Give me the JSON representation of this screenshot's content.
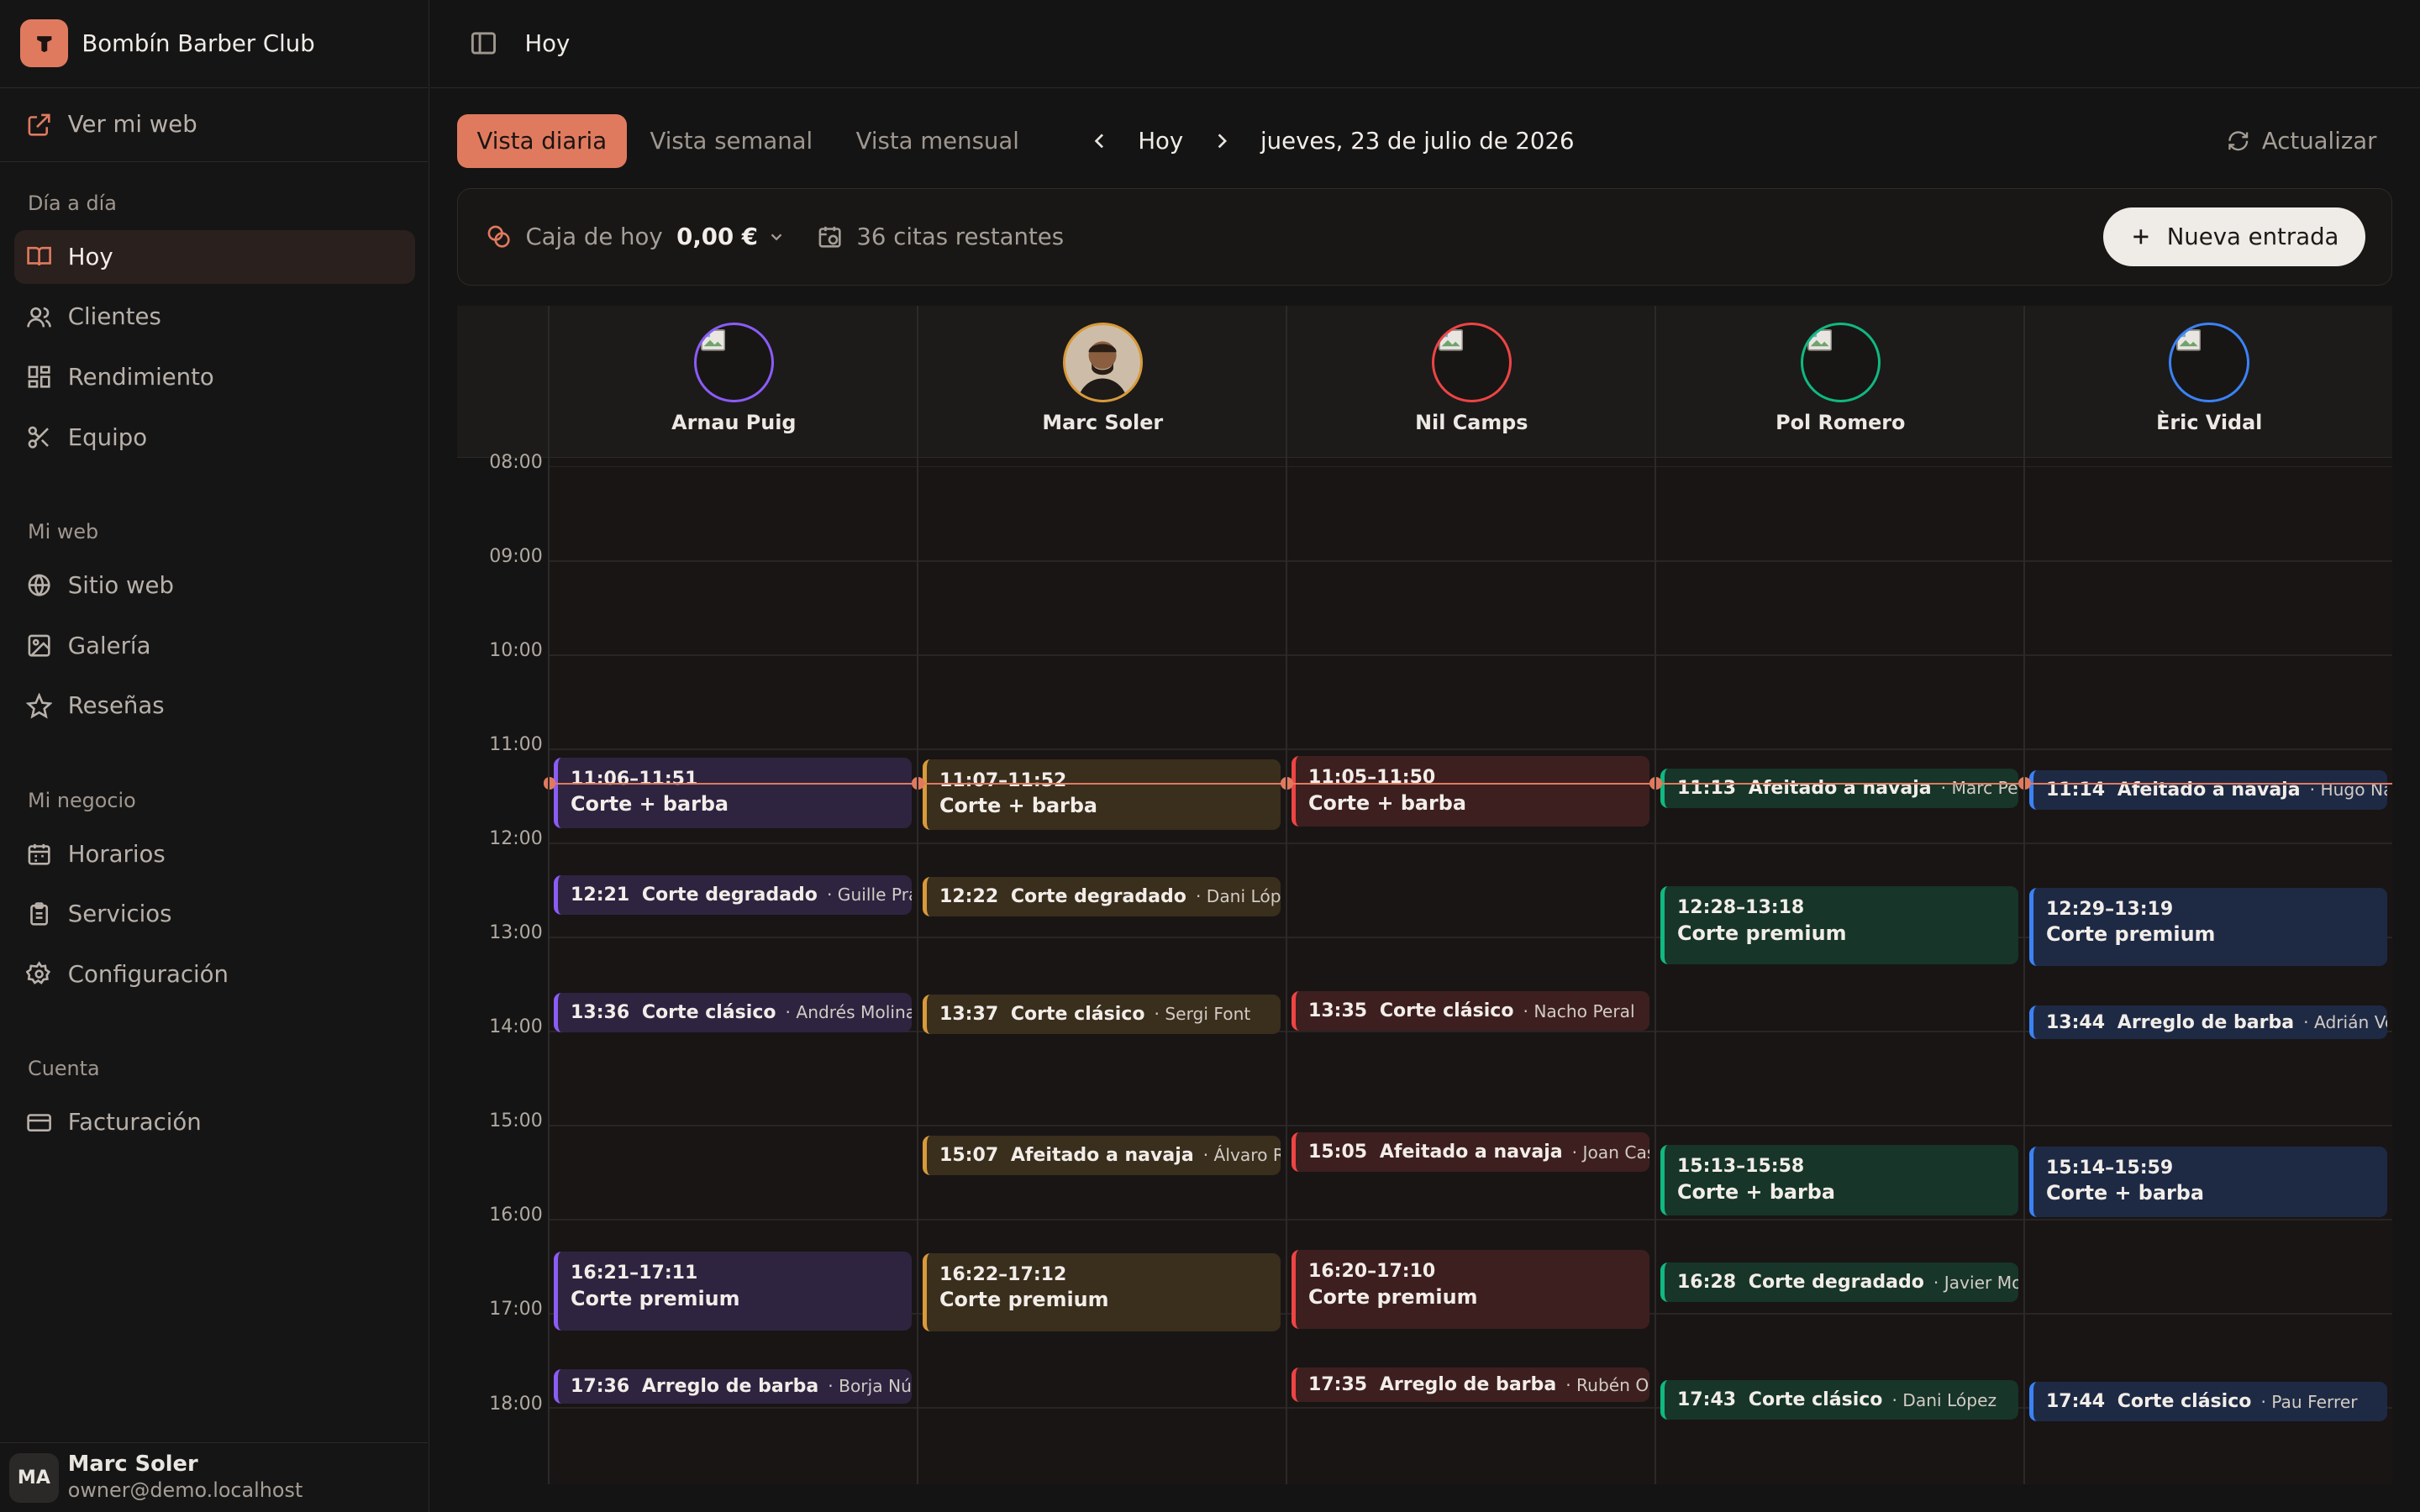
{
  "brand": {
    "name": "Bombín Barber Club",
    "accent": "#e07a5f"
  },
  "weblink": {
    "label": "Ver mi web",
    "icon": "external-link-icon"
  },
  "sidebar": {
    "sections": [
      {
        "title": "Día a día",
        "items": [
          {
            "label": "Hoy",
            "icon": "book-icon",
            "active": true
          },
          {
            "label": "Clientes",
            "icon": "users-icon"
          },
          {
            "label": "Rendimiento",
            "icon": "dashboard-icon"
          },
          {
            "label": "Equipo",
            "icon": "scissors-icon"
          }
        ]
      },
      {
        "title": "Mi web",
        "items": [
          {
            "label": "Sitio web",
            "icon": "globe-icon"
          },
          {
            "label": "Galería",
            "icon": "image-icon"
          },
          {
            "label": "Reseñas",
            "icon": "star-icon"
          }
        ]
      },
      {
        "title": "Mi negocio",
        "items": [
          {
            "label": "Horarios",
            "icon": "calendar-icon"
          },
          {
            "label": "Servicios",
            "icon": "clipboard-icon"
          },
          {
            "label": "Configuración",
            "icon": "gear-icon"
          }
        ]
      },
      {
        "title": "Cuenta",
        "items": [
          {
            "label": "Facturación",
            "icon": "credit-card-icon"
          }
        ]
      }
    ]
  },
  "user": {
    "initials": "MA",
    "name": "Marc Soler",
    "email": "owner@demo.localhost"
  },
  "topbar": {
    "title": "Hoy"
  },
  "views": {
    "daily": "Vista diaria",
    "weekly": "Vista semanal",
    "monthly": "Vista mensual",
    "today": "Hoy",
    "date": "jueves, 23 de julio de 2026",
    "refresh": "Actualizar"
  },
  "summary": {
    "cash_label": "Caja de hoy",
    "cash_value": "0,00 €",
    "remaining": "36 citas restantes",
    "new_entry": "Nueva entrada"
  },
  "hours": [
    "08:00",
    "09:00",
    "10:00",
    "11:00",
    "12:00",
    "13:00",
    "14:00",
    "15:00",
    "16:00",
    "17:00",
    "18:00"
  ],
  "staff": [
    {
      "name": "Arnau Puig",
      "color": "#8b5cf6",
      "bg": "#2e2440"
    },
    {
      "name": "Marc Soler",
      "color": "#d99a3a",
      "bg": "#3a2e1d",
      "photo": true
    },
    {
      "name": "Nil Camps",
      "color": "#ef4444",
      "bg": "#3d1f1f"
    },
    {
      "name": "Pol Romero",
      "color": "#10b981",
      "bg": "#173529"
    },
    {
      "name": "Èric Vidal",
      "color": "#3b82f6",
      "bg": "#1e2a44"
    }
  ],
  "appointments": [
    {
      "staff": 0,
      "start": "11:06",
      "end": "11:51",
      "service": "Corte + barba",
      "client": "",
      "time": "11:06–11:51"
    },
    {
      "staff": 0,
      "start": "12:21",
      "end": "12:46",
      "service": "Corte degradado",
      "client": "· Guille Prat",
      "time": "12:21"
    },
    {
      "staff": 0,
      "start": "13:36",
      "end": "14:01",
      "service": "Corte clásico",
      "client": "· Andrés Molina",
      "time": "13:36"
    },
    {
      "staff": 0,
      "start": "16:21",
      "end": "17:11",
      "service": "Corte premium",
      "client": "",
      "time": "16:21–17:11"
    },
    {
      "staff": 0,
      "start": "17:36",
      "end": "17:56",
      "service": "Arreglo de barba",
      "client": "· Borja Núñez",
      "time": "17:36"
    },
    {
      "staff": 1,
      "start": "11:07",
      "end": "11:52",
      "service": "Corte + barba",
      "client": "",
      "time": "11:07–11:52"
    },
    {
      "staff": 1,
      "start": "12:22",
      "end": "12:47",
      "service": "Corte degradado",
      "client": "· Dani López",
      "time": "12:22"
    },
    {
      "staff": 1,
      "start": "13:37",
      "end": "14:02",
      "service": "Corte clásico",
      "client": "· Sergi Font",
      "time": "13:37"
    },
    {
      "staff": 1,
      "start": "15:07",
      "end": "15:32",
      "service": "Afeitado a navaja",
      "client": "· Álvaro Ruiz",
      "time": "15:07"
    },
    {
      "staff": 1,
      "start": "16:22",
      "end": "17:12",
      "service": "Corte premium",
      "client": "",
      "time": "16:22–17:12"
    },
    {
      "staff": 2,
      "start": "11:05",
      "end": "11:50",
      "service": "Corte + barba",
      "client": "",
      "time": "11:05–11:50"
    },
    {
      "staff": 2,
      "start": "13:35",
      "end": "14:00",
      "service": "Corte clásico",
      "client": "· Nacho Peral",
      "time": "13:35"
    },
    {
      "staff": 2,
      "start": "15:05",
      "end": "15:30",
      "service": "Afeitado a navaja",
      "client": "· Joan Casals",
      "time": "15:05"
    },
    {
      "staff": 2,
      "start": "16:20",
      "end": "17:10",
      "service": "Corte premium",
      "client": "",
      "time": "16:20–17:10"
    },
    {
      "staff": 2,
      "start": "17:35",
      "end": "17:55",
      "service": "Arreglo de barba",
      "client": "· Rubén Ortega",
      "time": "17:35"
    },
    {
      "staff": 3,
      "start": "11:13",
      "end": "11:38",
      "service": "Afeitado a navaja",
      "client": "· Marc Peña",
      "time": "11:13"
    },
    {
      "staff": 3,
      "start": "12:28",
      "end": "13:18",
      "service": "Corte premium",
      "client": "",
      "time": "12:28–13:18"
    },
    {
      "staff": 3,
      "start": "15:13",
      "end": "15:58",
      "service": "Corte + barba",
      "client": "",
      "time": "15:13–15:58"
    },
    {
      "staff": 3,
      "start": "16:28",
      "end": "16:53",
      "service": "Corte degradado",
      "client": "· Javier Morales",
      "time": "16:28"
    },
    {
      "staff": 3,
      "start": "17:43",
      "end": "18:08",
      "service": "Corte clásico",
      "client": "· Dani López",
      "time": "17:43"
    },
    {
      "staff": 4,
      "start": "11:14",
      "end": "11:39",
      "service": "Afeitado a navaja",
      "client": "· Hugo Navarro",
      "time": "11:14"
    },
    {
      "staff": 4,
      "start": "12:29",
      "end": "13:19",
      "service": "Corte premium",
      "client": "",
      "time": "12:29–13:19"
    },
    {
      "staff": 4,
      "start": "13:44",
      "end": "14:04",
      "service": "Arreglo de barba",
      "client": "· Adrián Vega",
      "time": "13:44"
    },
    {
      "staff": 4,
      "start": "15:14",
      "end": "15:59",
      "service": "Corte + barba",
      "client": "",
      "time": "15:14–15:59"
    },
    {
      "staff": 4,
      "start": "17:44",
      "end": "18:09",
      "service": "Corte clásico",
      "client": "· Pau Ferrer",
      "time": "17:44"
    }
  ],
  "now": "11:22"
}
